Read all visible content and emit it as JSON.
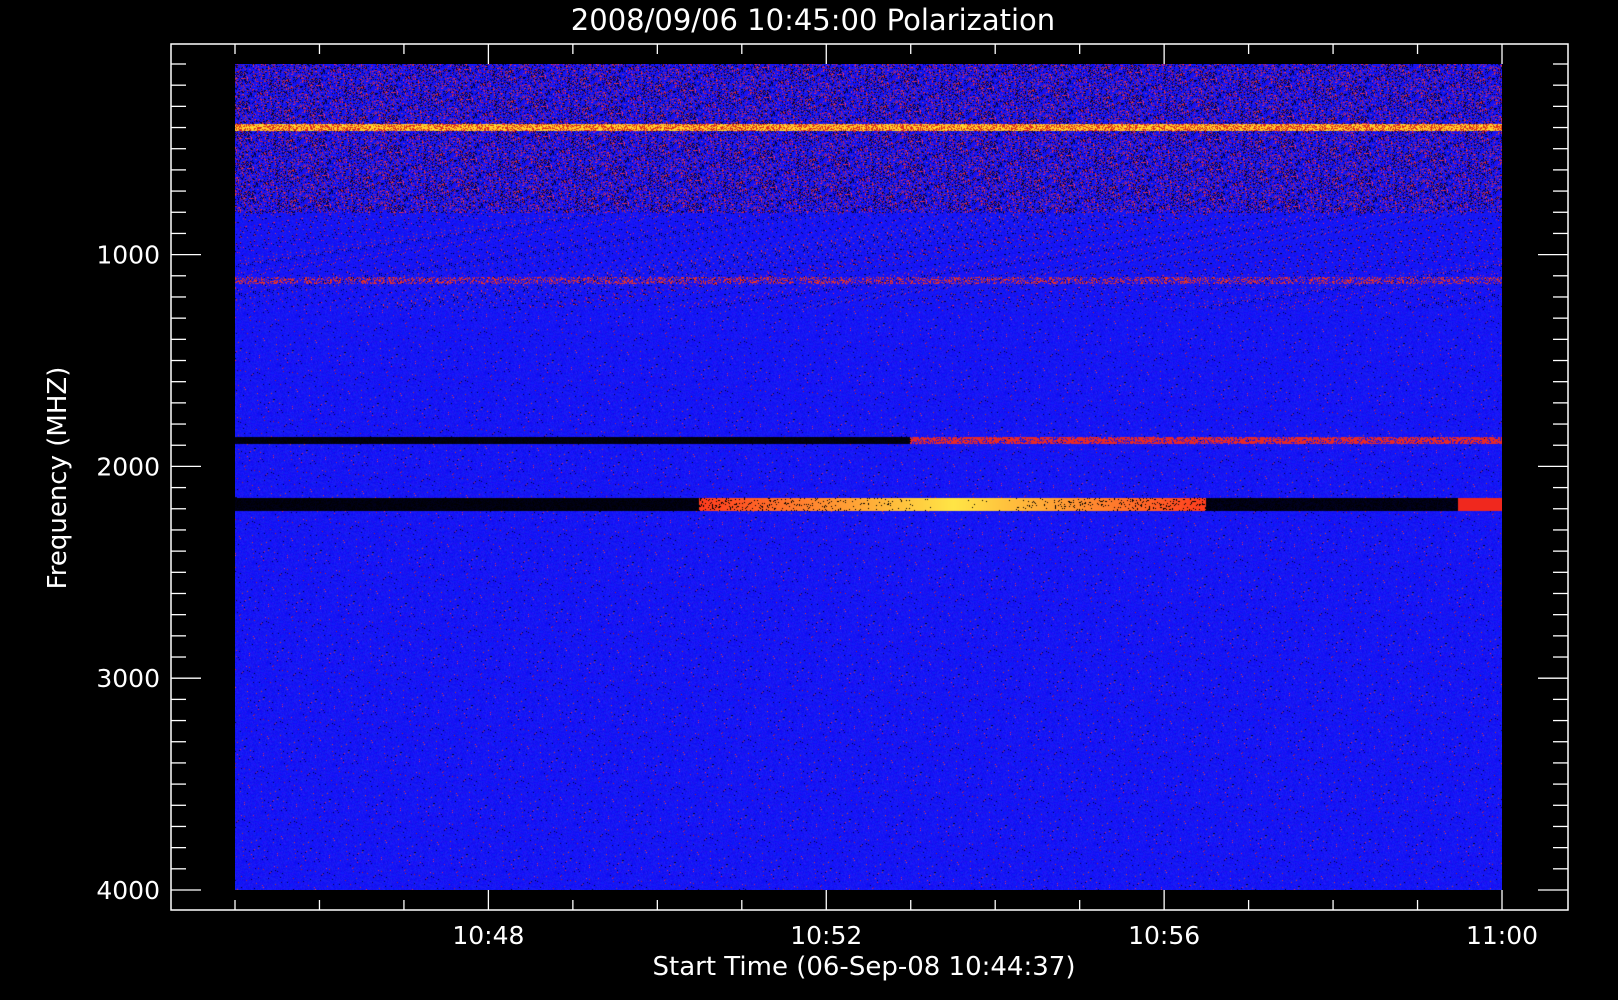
{
  "chart_data": {
    "type": "heatmap",
    "title": "2008/09/06 10:45:00 Polarization",
    "xlabel": "Start Time (06-Sep-08 10:44:37)",
    "ylabel": "Frequency (MHZ)",
    "x_range": [
      "10:45:00",
      "11:00:00"
    ],
    "y_range": [
      100,
      4000
    ],
    "y_reversed": true,
    "x_ticks": [
      "10:48",
      "10:52",
      "10:56",
      "11:00"
    ],
    "y_ticks": [
      1000,
      2000,
      3000,
      4000
    ],
    "colormap": {
      "low": "#000000",
      "mid": "#0a14ff",
      "high": "#ff2a10",
      "peak": "#ffe65a"
    },
    "background_level": "blue (mid)",
    "features": [
      {
        "name": "interference band",
        "freq_mhz": [
          100,
          800
        ],
        "time": [
          "10:45:00",
          "11:00:00"
        ],
        "pattern": "speckled red/black"
      },
      {
        "name": "bright line",
        "freq_mhz": 400,
        "time": [
          "10:45:00",
          "11:00:00"
        ],
        "pattern": "yellow/orange"
      },
      {
        "name": "red dashes",
        "freq_mhz": 1120,
        "time": [
          "10:45:00",
          "11:00:00"
        ],
        "pattern": "dashed red"
      },
      {
        "name": "band",
        "freq_mhz": 1880,
        "time": [
          "10:45:00",
          "10:53:00"
        ],
        "pattern": "dark black"
      },
      {
        "name": "band",
        "freq_mhz": 1880,
        "time": [
          "10:53:00",
          "11:00:00"
        ],
        "pattern": "red"
      },
      {
        "name": "band",
        "freq_mhz": 2180,
        "time": [
          "10:45:00",
          "10:50:30"
        ],
        "pattern": "black"
      },
      {
        "name": "band",
        "freq_mhz": 2180,
        "time": [
          "10:50:30",
          "10:56:30"
        ],
        "pattern": "orange/yellow peak"
      },
      {
        "name": "band",
        "freq_mhz": 2180,
        "time": [
          "10:56:30",
          "11:00:00"
        ],
        "pattern": "black then red"
      }
    ]
  }
}
